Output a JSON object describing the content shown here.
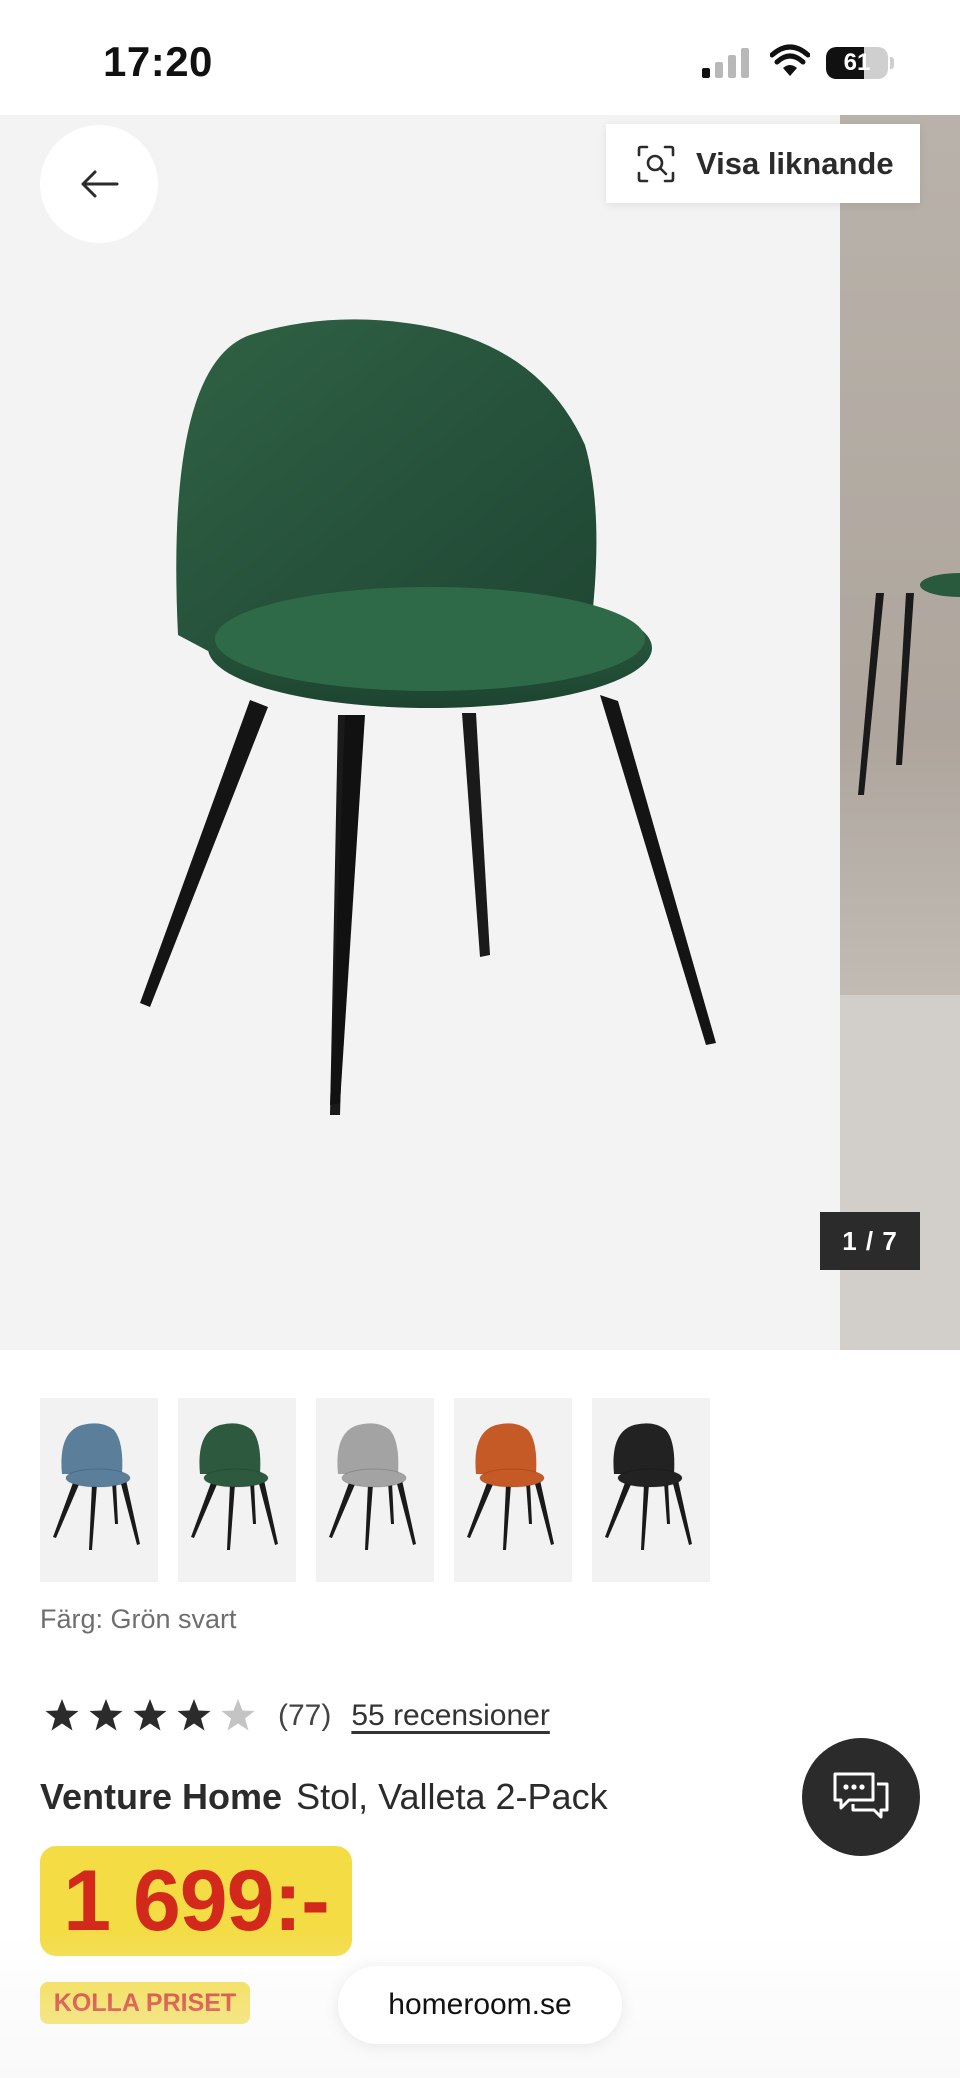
{
  "status_bar": {
    "time": "17:20",
    "battery_percent": "61",
    "battery_level": 0.61,
    "signal_bars_active": 1,
    "icons": [
      "signal-icon",
      "wifi-icon",
      "battery-icon"
    ]
  },
  "gallery": {
    "back_icon": "arrow-left-icon",
    "similar_label": "Visa liknande",
    "similar_icon": "visual-search-icon",
    "counter": "1 / 7",
    "current_image": 1,
    "total_images": 7
  },
  "thumbnails": [
    {
      "color": "#5b7f9b",
      "name": "blue"
    },
    {
      "color": "#2d5a3f",
      "name": "green"
    },
    {
      "color": "#a3a3a3",
      "name": "grey"
    },
    {
      "color": "#c65a26",
      "name": "orange"
    },
    {
      "color": "#222222",
      "name": "black"
    }
  ],
  "product": {
    "color_line": "Färg: Grön svart",
    "rating": 4,
    "rating_max": 5,
    "rating_count": "(77)",
    "reviews_link": "55 recensioner",
    "brand": "Venture Home",
    "name": "Stol, Valleta 2-Pack",
    "price": "1 699:-",
    "promo_label": "KOLLA PRISET"
  },
  "chat": {
    "icon": "chat-icon"
  },
  "browser": {
    "url": "homeroom.se"
  },
  "colors": {
    "price_yellow": "#f3dc44",
    "price_red": "#d2291c",
    "dark": "#2b2b2b",
    "chair_green": "#2d5a3f"
  }
}
